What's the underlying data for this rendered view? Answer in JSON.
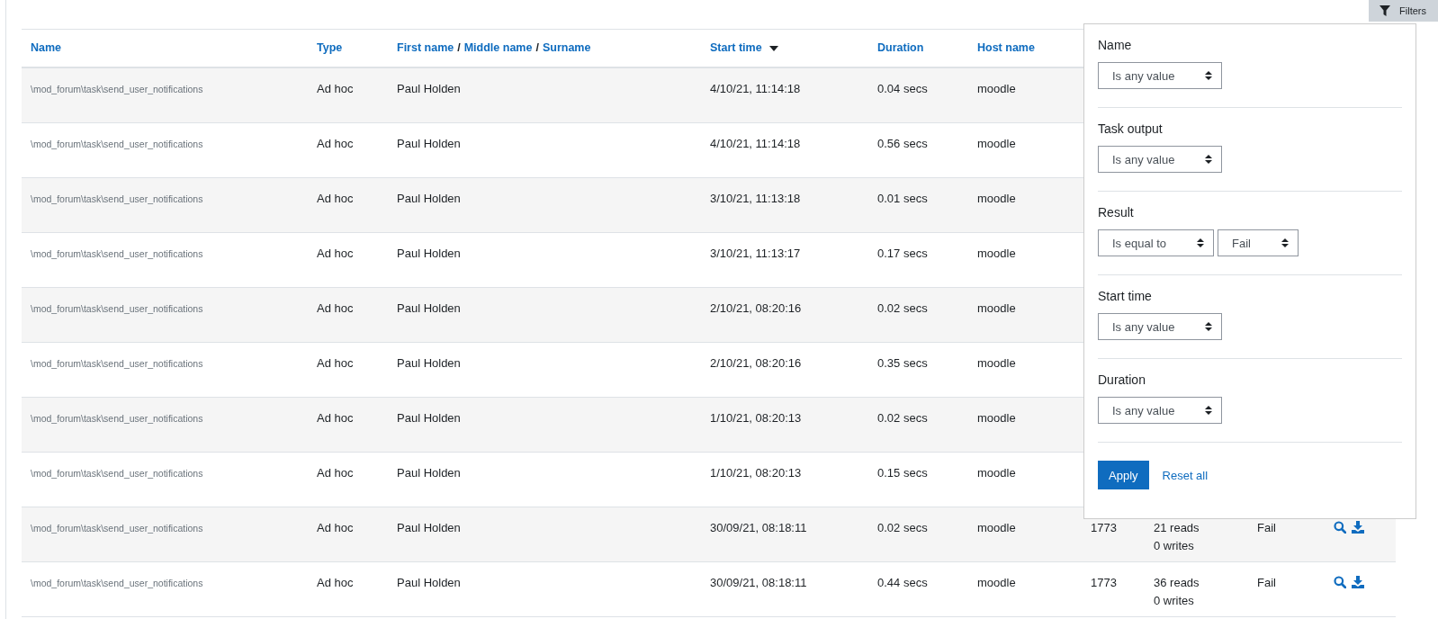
{
  "filters_button": {
    "label": "Filters"
  },
  "table": {
    "columns": [
      {
        "parts": [
          "Name"
        ]
      },
      {
        "parts": [
          "Type"
        ]
      },
      {
        "parts": [
          "First name",
          "Middle name",
          "Surname"
        ],
        "separator": "/"
      },
      {
        "parts": [
          "Start time"
        ],
        "sort_descending": true
      },
      {
        "parts": [
          "Duration"
        ]
      },
      {
        "parts": [
          "Host name"
        ]
      }
    ],
    "rows": [
      {
        "name": "\\mod_forum\\task\\send_user_notifications",
        "type": "Ad hoc",
        "user": "Paul Holden",
        "start": "4/10/21, 11:14:18",
        "duration": "0.04 secs",
        "host": "moodle"
      },
      {
        "name": "\\mod_forum\\task\\send_user_notifications",
        "type": "Ad hoc",
        "user": "Paul Holden",
        "start": "4/10/21, 11:14:18",
        "duration": "0.56 secs",
        "host": "moodle"
      },
      {
        "name": "\\mod_forum\\task\\send_user_notifications",
        "type": "Ad hoc",
        "user": "Paul Holden",
        "start": "3/10/21, 11:13:18",
        "duration": "0.01 secs",
        "host": "moodle"
      },
      {
        "name": "\\mod_forum\\task\\send_user_notifications",
        "type": "Ad hoc",
        "user": "Paul Holden",
        "start": "3/10/21, 11:13:17",
        "duration": "0.17 secs",
        "host": "moodle"
      },
      {
        "name": "\\mod_forum\\task\\send_user_notifications",
        "type": "Ad hoc",
        "user": "Paul Holden",
        "start": "2/10/21, 08:20:16",
        "duration": "0.02 secs",
        "host": "moodle"
      },
      {
        "name": "\\mod_forum\\task\\send_user_notifications",
        "type": "Ad hoc",
        "user": "Paul Holden",
        "start": "2/10/21, 08:20:16",
        "duration": "0.35 secs",
        "host": "moodle"
      },
      {
        "name": "\\mod_forum\\task\\send_user_notifications",
        "type": "Ad hoc",
        "user": "Paul Holden",
        "start": "1/10/21, 08:20:13",
        "duration": "0.02 secs",
        "host": "moodle"
      },
      {
        "name": "\\mod_forum\\task\\send_user_notifications",
        "type": "Ad hoc",
        "user": "Paul Holden",
        "start": "1/10/21, 08:20:13",
        "duration": "0.15 secs",
        "host": "moodle"
      },
      {
        "name": "\\mod_forum\\task\\send_user_notifications",
        "type": "Ad hoc",
        "user": "Paul Holden",
        "start": "30/09/21, 08:18:11",
        "duration": "0.02 secs",
        "host": "moodle",
        "pid": "1773",
        "reads": "21 reads",
        "writes": "0 writes",
        "result": "Fail"
      },
      {
        "name": "\\mod_forum\\task\\send_user_notifications",
        "type": "Ad hoc",
        "user": "Paul Holden",
        "start": "30/09/21, 08:18:11",
        "duration": "0.44 secs",
        "host": "moodle",
        "pid": "1773",
        "reads": "36 reads",
        "writes": "0 writes",
        "result": "Fail"
      }
    ]
  },
  "filters": {
    "items": [
      {
        "label": "Name",
        "selects": [
          "Is any value"
        ]
      },
      {
        "label": "Task output",
        "selects": [
          "Is any value"
        ]
      },
      {
        "label": "Result",
        "selects": [
          "Is equal to",
          "Fail"
        ]
      },
      {
        "label": "Start time",
        "selects": [
          "Is any value"
        ]
      },
      {
        "label": "Duration",
        "selects": [
          "Is any value"
        ]
      }
    ],
    "apply": "Apply",
    "reset": "Reset all"
  }
}
